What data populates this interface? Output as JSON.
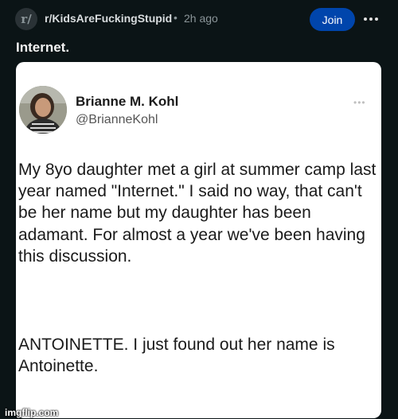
{
  "post": {
    "subreddit": "r/KidsAreFuckingStupid",
    "separator": "•",
    "time": "2h ago",
    "join_label": "Join",
    "title": "Internet."
  },
  "tweet": {
    "name": "Brianne M. Kohl",
    "handle": "@BrianneKohl",
    "more": "•••",
    "paragraph1": "My 8yo daughter met a girl at summer camp last year named \"Internet.\" I said no way, that can't be her name but my daughter has been adamant. For almost a year we've been having this discussion.",
    "paragraph2": "ANTOINETTE. I just found out her name is Antoinette."
  },
  "watermark": "imgflip.com",
  "colors": {
    "background": "#0b1416",
    "join_button": "#0045ac",
    "card": "#ffffff"
  }
}
